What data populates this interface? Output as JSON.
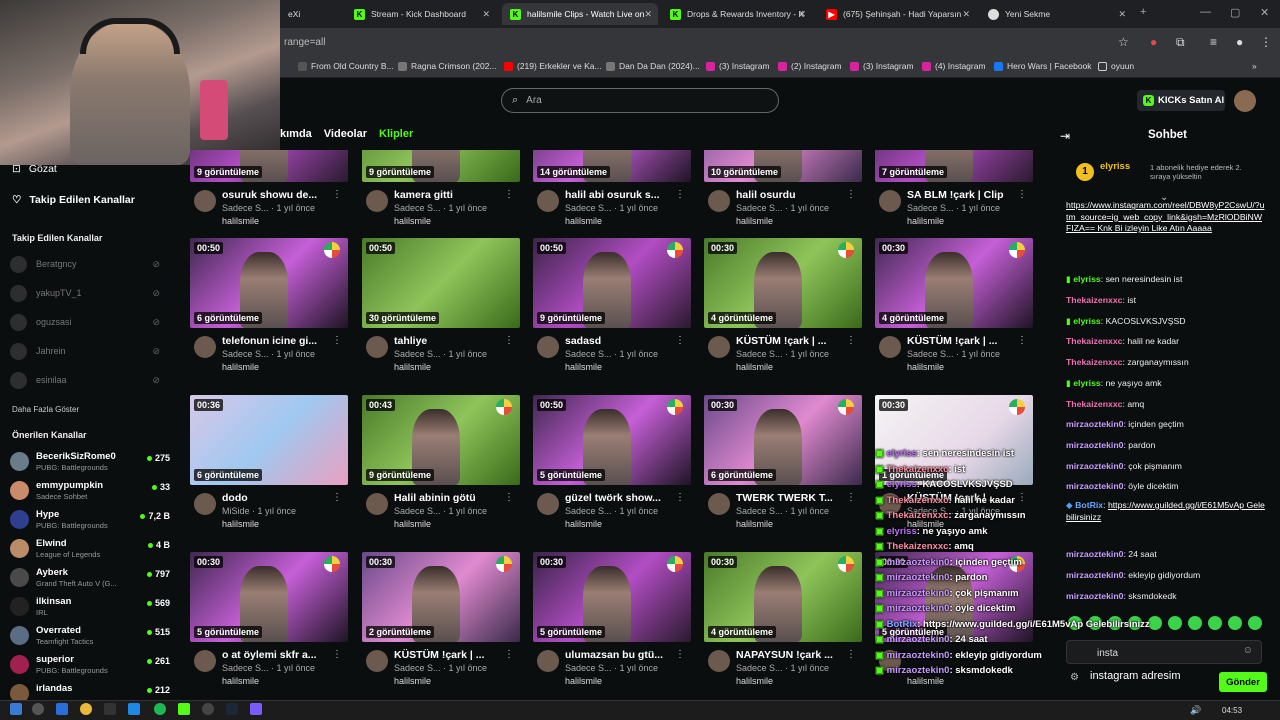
{
  "browser": {
    "tabs": [
      {
        "label": "eXia"
      },
      {
        "label": "Stream - Kick Dashboard"
      },
      {
        "label": "halilsmile Clips - Watch Live on"
      },
      {
        "label": "Drops & Rewards Inventory - K"
      },
      {
        "label": "(675) Şehinşah - Hadi Yaparsın"
      },
      {
        "label": "Yeni Sekme"
      }
    ],
    "url": "range=all",
    "bookmarks": [
      "From Old Country B...",
      "Ragna Crimson (202...",
      "(219) Erkekler ve Ka...",
      "Dan Da Dan (2024)...",
      "(3) Instagram",
      "(2) Instagram",
      "(3) Instagram",
      "(4) Instagram",
      "Hero Wars | Facebook",
      "oyuun"
    ]
  },
  "header": {
    "search_placeholder": "Ara",
    "kicks_button": "KICKs Satın Al"
  },
  "sidebar": {
    "browse": "Gözat",
    "following": "Takip Edilen Kanallar",
    "following_title": "Takip Edilen Kanallar",
    "offline_channels": [
      "Beratgncy",
      "yakupTV_1",
      "oguzsasi",
      "Jahrein",
      "esinilaa"
    ],
    "show_more": "Daha Fazla Göster",
    "recommended_title": "Önerilen Kanallar",
    "recommended": [
      {
        "name": "BecerikSizRome0",
        "game": "PUBG: Battlegrounds",
        "viewers": "275"
      },
      {
        "name": "emmypumpkin",
        "game": "Sadece Sohbet",
        "viewers": "33"
      },
      {
        "name": "Hype",
        "game": "PUBG: Battlegrounds",
        "viewers": "7,2 B"
      },
      {
        "name": "Elwind",
        "game": "League of Legends",
        "viewers": "4 B"
      },
      {
        "name": "Ayberk",
        "game": "Grand Theft Auto V (G...",
        "viewers": "797"
      },
      {
        "name": "ilkinsan",
        "game": "IRL",
        "viewers": "569"
      },
      {
        "name": "Overrated",
        "game": "Teamfight Tactics",
        "viewers": "515"
      },
      {
        "name": "superior",
        "game": "PUBG: Battlegrounds",
        "viewers": "261"
      },
      {
        "name": "irlandas",
        "game": "",
        "viewers": "212"
      }
    ]
  },
  "channel_tabs": [
    "kımda",
    "Videolar",
    "Klipler"
  ],
  "clips": [
    {
      "duration": "",
      "views": "9 görüntüleme",
      "title": "osuruk showu de...",
      "category": "Sadece S...",
      "age": "1 yıl önce",
      "channel": "halilsmile"
    },
    {
      "duration": "",
      "views": "9 görüntüleme",
      "title": "kamera gitti",
      "category": "Sadece S...",
      "age": "1 yıl önce",
      "channel": "halilsmile"
    },
    {
      "duration": "",
      "views": "14 görüntüleme",
      "title": "halil abi osuruk s...",
      "category": "Sadece S...",
      "age": "1 yıl önce",
      "channel": "halilsmile"
    },
    {
      "duration": "",
      "views": "10 görüntüleme",
      "title": "halil osurdu",
      "category": "Sadece S...",
      "age": "1 yıl önce",
      "channel": "halilsmile"
    },
    {
      "duration": "",
      "views": "7 görüntüleme",
      "title": "SA BLM !çark | Clip",
      "category": "Sadece S...",
      "age": "1 yıl önce",
      "channel": "halilsmile"
    },
    {
      "duration": "00:50",
      "views": "6 görüntüleme",
      "title": "telefonun icine gi...",
      "category": "Sadece S...",
      "age": "1 yıl önce",
      "channel": "halilsmile"
    },
    {
      "duration": "00:50",
      "views": "30 görüntüleme",
      "title": "tahliye",
      "category": "Sadece S...",
      "age": "1 yıl önce",
      "channel": "halilsmile"
    },
    {
      "duration": "00:50",
      "views": "9 görüntüleme",
      "title": "sadasd",
      "category": "Sadece S...",
      "age": "1 yıl önce",
      "channel": "halilsmile"
    },
    {
      "duration": "00:30",
      "views": "4 görüntüleme",
      "title": "KÜSTÜM !çark | ...",
      "category": "Sadece S...",
      "age": "1 yıl önce",
      "channel": "halilsmile"
    },
    {
      "duration": "00:30",
      "views": "4 görüntüleme",
      "title": "KÜSTÜM !çark | ...",
      "category": "Sadece S...",
      "age": "1 yıl önce",
      "channel": "halilsmile"
    },
    {
      "duration": "00:36",
      "views": "6 görüntüleme",
      "title": "dodo",
      "category": "MiSide",
      "age": "1 yıl önce",
      "channel": "halilsmile"
    },
    {
      "duration": "00:43",
      "views": "9 görüntüleme",
      "title": "Halil abinin götü",
      "category": "Sadece S...",
      "age": "1 yıl önce",
      "channel": "halilsmile"
    },
    {
      "duration": "00:50",
      "views": "5 görüntüleme",
      "title": "güzel twörk show...",
      "category": "Sadece S...",
      "age": "1 yıl önce",
      "channel": "halilsmile"
    },
    {
      "duration": "00:30",
      "views": "6 görüntüleme",
      "title": "TWERK TWERK T...",
      "category": "Sadece S...",
      "age": "1 yıl önce",
      "channel": "halilsmile"
    },
    {
      "duration": "00:30",
      "views": "1 görüntüleme",
      "title": "KÜSTÜM !çark | ...",
      "category": "Sadece S...",
      "age": "1 yıl önce",
      "channel": "halilsmile"
    },
    {
      "duration": "00:30",
      "views": "5 görüntüleme",
      "title": "o at öylemi skfr a...",
      "category": "Sadece S...",
      "age": "1 yıl önce",
      "channel": "halilsmile"
    },
    {
      "duration": "00:30",
      "views": "2 görüntüleme",
      "title": "KÜSTÜM !çark | ...",
      "category": "Sadece S...",
      "age": "1 yıl önce",
      "channel": "halilsmile"
    },
    {
      "duration": "00:30",
      "views": "5 görüntüleme",
      "title": "ulumazsan bu gtü...",
      "category": "Sadece S...",
      "age": "1 yıl önce",
      "channel": "halilsmile"
    },
    {
      "duration": "00:30",
      "views": "4 görüntüleme",
      "title": "NAPAYSUN !çark ...",
      "category": "Sadece S...",
      "age": "1 yıl önce",
      "channel": "halilsmile"
    },
    {
      "duration": "00:30",
      "views": "5 görüntüleme",
      "title": "",
      "category": "",
      "age": "",
      "channel": "halilsmile"
    }
  ],
  "chat": {
    "title": "Sohbet",
    "pinned_user": "elyriss",
    "pinned_text": "1 abonelik hediye ederek 2. sıraya yükseltin",
    "messages": [
      {
        "user": "",
        "text": "https://www.instagram.com/reel/DBW8yP2CswU/?utm_source=ig_web_copy_link&igsh=MzRlODBiNWFIZA== Knk Bi izleyin Like Atın Aaaaa"
      },
      {
        "user": "elyriss",
        "text": "sen neresindesin ist"
      },
      {
        "user": "Thekaizenxxc",
        "text": "ist"
      },
      {
        "user": "elyriss",
        "text": "KACOSLVKSJVŞSD"
      },
      {
        "user": "Thekaizenxxc",
        "text": "halil ne kadar"
      },
      {
        "user": "Thekaizenxxc",
        "text": "zarganaymıssın"
      },
      {
        "user": "elyriss",
        "text": "ne yaşıyo amk"
      },
      {
        "user": "Thekaizenxxc",
        "text": "amq"
      },
      {
        "user": "mirzaoztekin0",
        "text": "içinden geçtim"
      },
      {
        "user": "mirzaoztekin0",
        "text": "pardon"
      },
      {
        "user": "mirzaoztekin0",
        "text": "çok pişmanım"
      },
      {
        "user": "mirzaoztekin0",
        "text": "öyle dicektim"
      },
      {
        "user": "BotRix",
        "text": "https://www.guilded.gg/i/E61M5vAp Gelebilirsinizz"
      },
      {
        "user": "mirzaoztekin0",
        "text": "24 saat"
      },
      {
        "user": "mirzaoztekin0",
        "text": "ekleyip gidiyordum"
      },
      {
        "user": "mirzaoztekin0",
        "text": "sksmdokedk"
      }
    ],
    "input_value": "instagram adresim",
    "input_overlay": "insta",
    "send_label": "Gönder"
  },
  "overlay_chat": [
    {
      "user": "elyriss",
      "text": ": sen neresindesin ist"
    },
    {
      "user": "Thekaizenxxc",
      "text": ": ist"
    },
    {
      "user": "elyriss",
      "text": ": KACOSLVKSJVŞSD"
    },
    {
      "user": "Thekaizenxxc",
      "text": ": halil ne kadar"
    },
    {
      "user": "Thekaizenxxc",
      "text": ": zarganaymıssın"
    },
    {
      "user": "elyriss",
      "text": ": ne yaşıyo amk"
    },
    {
      "user": "Thekaizenxxc",
      "text": ": amq"
    },
    {
      "user": "mirzaoztekin0",
      "text": ": içinden geçtim"
    },
    {
      "user": "mirzaoztekin0",
      "text": ": pardon"
    },
    {
      "user": "mirzaoztekin0",
      "text": ": çok pişmanım"
    },
    {
      "user": "mirzaoztekin0",
      "text": ": öyle dicektim"
    },
    {
      "user": "BotRix",
      "text": ": https://www.guilded.gg/i/E61M5vAp Gelebilirsinizz"
    },
    {
      "user": "mirzaoztekin0",
      "text": ": 24 saat"
    },
    {
      "user": "mirzaoztekin0",
      "text": ": ekleyip gidiyordum"
    },
    {
      "user": "mirzaoztekin0",
      "text": ": sksmdokedk"
    }
  ],
  "taskbar": {
    "time": "04:53"
  },
  "colors": {
    "accent": "#53fc18",
    "bg": "#0b0e0f",
    "chat_user_pink": "#f06fb2"
  }
}
